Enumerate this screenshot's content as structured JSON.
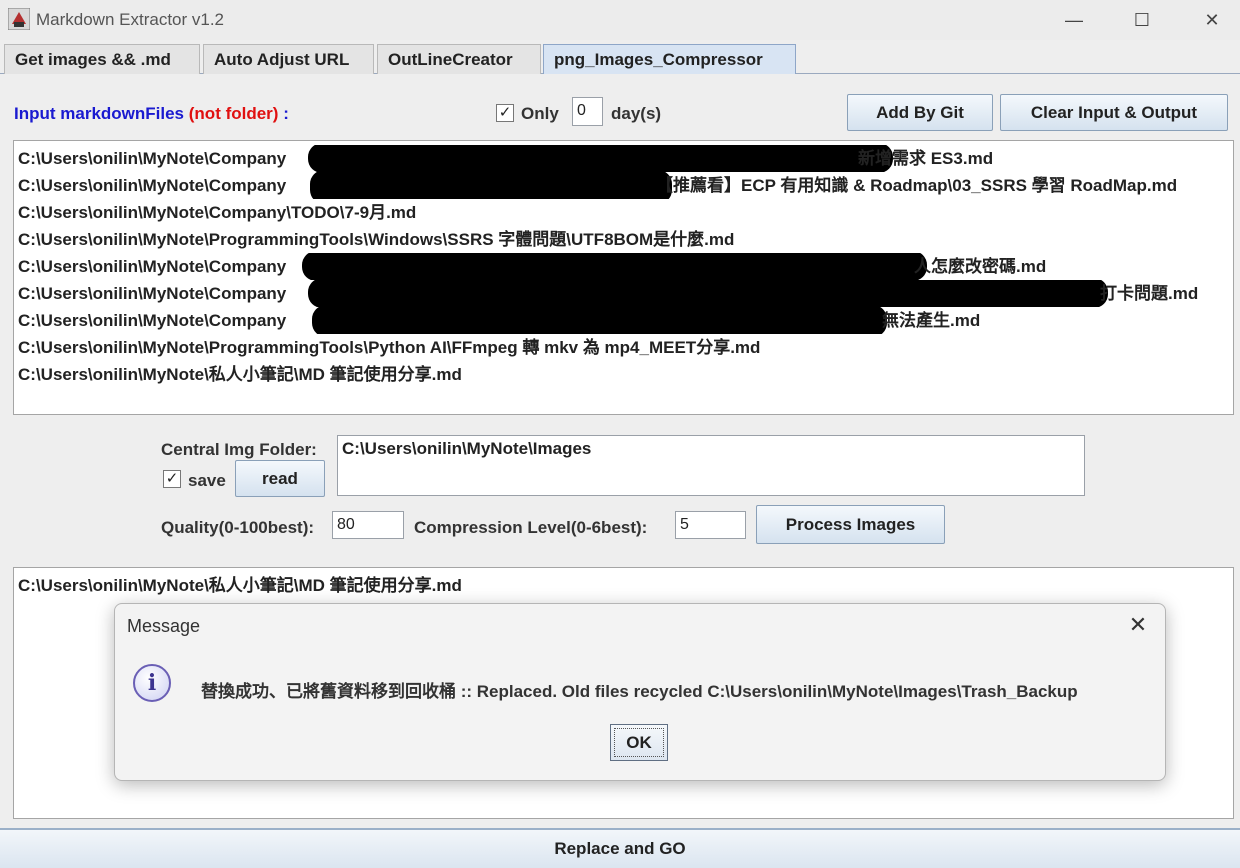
{
  "window": {
    "title": "Markdown Extractor v1.2",
    "minimize": "—",
    "maximize": "☐",
    "close": "✕"
  },
  "tabs": [
    {
      "label": "Get images && .md"
    },
    {
      "label": "Auto Adjust URL"
    },
    {
      "label": "OutLineCreator"
    },
    {
      "label": "png_Images_Compressor"
    }
  ],
  "input_section": {
    "label_main": "Input markdownFiles",
    "label_note": "(not folder)",
    "label_colon": ":",
    "only_checked": "✓",
    "only_label": "Only",
    "days_value": "0",
    "days_label": "day(s)",
    "add_by_git": "Add By Git",
    "clear_button": "Clear Input & Output"
  },
  "input_files": [
    {
      "prefix": "C:\\Users\\onilin\\MyNote\\Company",
      "suffix": "新增需求 ES3.md"
    },
    {
      "prefix": "C:\\Users\\onilin\\MyNote\\Company",
      "suffix": "【推薦看】ECP 有用知識 & Roadmap\\03_SSRS 學習 RoadMap.md"
    },
    {
      "prefix": "C:\\Users\\onilin\\MyNote\\Company\\TODO\\7-9月.md",
      "suffix": ""
    },
    {
      "prefix": "C:\\Users\\onilin\\MyNote\\ProgrammingTools\\Windows\\SSRS 字體問題\\UTF8BOM是什麼.md",
      "suffix": ""
    },
    {
      "prefix": "C:\\Users\\onilin\\MyNote\\Company",
      "suffix": "人怎麼改密碼.md"
    },
    {
      "prefix": "C:\\Users\\onilin\\MyNote\\Company",
      "suffix": "打卡問題.md"
    },
    {
      "prefix": "C:\\Users\\onilin\\MyNote\\Company",
      "suffix": "無法產生.md"
    },
    {
      "prefix": "C:\\Users\\onilin\\MyNote\\ProgrammingTools\\Python AI\\FFmpeg 轉 mkv 為 mp4_MEET分享.md",
      "suffix": ""
    },
    {
      "prefix": "C:\\Users\\onilin\\MyNote\\私人小筆記\\MD 筆記使用分享.md",
      "suffix": ""
    }
  ],
  "central": {
    "label": "Central Img Folder:",
    "folder_value": "C:\\Users\\onilin\\MyNote\\Images",
    "save_checked": "✓",
    "save_label": "save",
    "read_button": "read"
  },
  "compress": {
    "quality_label": "Quality(0-100best):",
    "quality_value": "80",
    "level_label": "Compression Level(0-6best):",
    "level_value": "5",
    "process_button": "Process Images"
  },
  "output_files": [
    "C:\\Users\\onilin\\MyNote\\私人小筆記\\MD 筆記使用分享.md"
  ],
  "dialog": {
    "title": "Message",
    "close": "✕",
    "icon": "i",
    "message": "替換成功、已將舊資料移到回收桶 :: Replaced. Old files recycled C:\\Users\\onilin\\MyNote\\Images\\Trash_Backup",
    "ok": "OK"
  },
  "bottom": {
    "replace_button": "Replace and GO"
  }
}
